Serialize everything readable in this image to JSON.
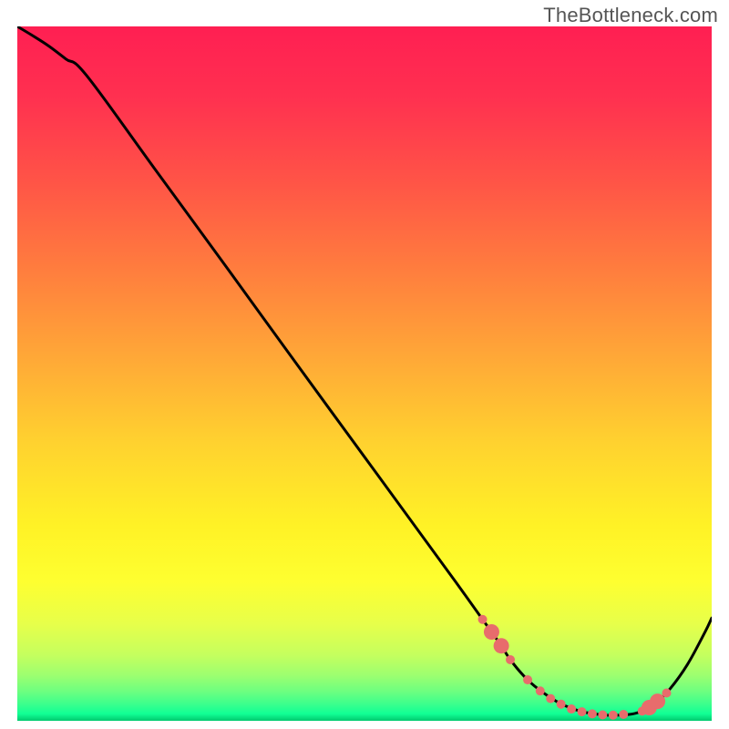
{
  "watermark": "TheBottleneck.com",
  "gradient": {
    "stops": [
      {
        "offset": 0.0,
        "color": "#ff1f52"
      },
      {
        "offset": 0.1,
        "color": "#ff3050"
      },
      {
        "offset": 0.22,
        "color": "#ff5347"
      },
      {
        "offset": 0.35,
        "color": "#ff7d3e"
      },
      {
        "offset": 0.48,
        "color": "#ffa937"
      },
      {
        "offset": 0.6,
        "color": "#ffd22f"
      },
      {
        "offset": 0.72,
        "color": "#fff226"
      },
      {
        "offset": 0.8,
        "color": "#feff30"
      },
      {
        "offset": 0.86,
        "color": "#e7ff4a"
      },
      {
        "offset": 0.905,
        "color": "#c5ff5e"
      },
      {
        "offset": 0.935,
        "color": "#9cff70"
      },
      {
        "offset": 0.958,
        "color": "#6cff80"
      },
      {
        "offset": 0.975,
        "color": "#3eff8c"
      },
      {
        "offset": 0.99,
        "color": "#11ff95"
      },
      {
        "offset": 1.0,
        "color": "#00c96f"
      }
    ]
  },
  "chart_data": {
    "type": "line",
    "title": "",
    "xlabel": "",
    "ylabel": "",
    "x_range": [
      0,
      100
    ],
    "y_range": [
      0,
      100
    ],
    "series": [
      {
        "name": "bottleneck-curve",
        "x": [
          0,
          2,
          4.5,
          7,
          10,
          20,
          30,
          40,
          50,
          60,
          64,
          67,
          69.5,
          71,
          73,
          75,
          78,
          81,
          83.5,
          85,
          88,
          90,
          92,
          94,
          96.5,
          99,
          100
        ],
        "y": [
          100,
          98.8,
          97.2,
          95.3,
          92.9,
          79.2,
          65.5,
          51.7,
          38.0,
          24.3,
          18.8,
          14.6,
          11.1,
          8.8,
          6.4,
          4.6,
          2.6,
          1.4,
          0.95,
          0.8,
          0.9,
          1.4,
          2.6,
          4.6,
          8.1,
          12.7,
          14.8
        ]
      }
    ],
    "markers": {
      "name": "bottleneck-zone-dots",
      "color": "#e86c6c",
      "radius_small": 5.0,
      "radius_large": 8.5,
      "points": [
        {
          "x": 67.0,
          "y": 14.6,
          "r": "small"
        },
        {
          "x": 68.3,
          "y": 12.8,
          "r": "large"
        },
        {
          "x": 69.7,
          "y": 10.8,
          "r": "large"
        },
        {
          "x": 71.0,
          "y": 8.8,
          "r": "small"
        },
        {
          "x": 73.5,
          "y": 5.9,
          "r": "small"
        },
        {
          "x": 75.3,
          "y": 4.3,
          "r": "small"
        },
        {
          "x": 76.8,
          "y": 3.2,
          "r": "small"
        },
        {
          "x": 78.3,
          "y": 2.4,
          "r": "small"
        },
        {
          "x": 79.8,
          "y": 1.7,
          "r": "small"
        },
        {
          "x": 81.3,
          "y": 1.3,
          "r": "small"
        },
        {
          "x": 82.8,
          "y": 1.0,
          "r": "small"
        },
        {
          "x": 84.3,
          "y": 0.85,
          "r": "small"
        },
        {
          "x": 85.8,
          "y": 0.82,
          "r": "small"
        },
        {
          "x": 87.3,
          "y": 0.92,
          "r": "small"
        },
        {
          "x": 90.0,
          "y": 1.4,
          "r": "small"
        },
        {
          "x": 91.0,
          "y": 1.9,
          "r": "large"
        },
        {
          "x": 92.2,
          "y": 2.8,
          "r": "large"
        },
        {
          "x": 93.5,
          "y": 4.0,
          "r": "small"
        }
      ]
    }
  }
}
